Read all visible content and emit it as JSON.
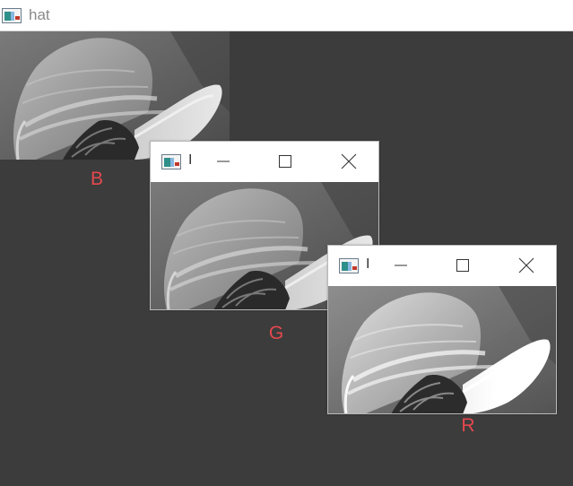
{
  "main_window": {
    "title": "hat",
    "icon": "app-window-icon"
  },
  "panels": [
    {
      "channel": "B",
      "label_color": "#e5484d"
    },
    {
      "channel": "G",
      "label_color": "#e5484d"
    },
    {
      "channel": "R",
      "label_color": "#e5484d"
    }
  ],
  "subwindows": [
    {
      "title": "I",
      "controls": [
        "minimize-icon",
        "maximize-icon",
        "close-icon"
      ]
    },
    {
      "title": "I",
      "controls": [
        "minimize-icon",
        "maximize-icon",
        "close-icon"
      ]
    }
  ],
  "colors": {
    "desktop_bg": "#3c3c3c",
    "label_red": "#e5484d"
  }
}
